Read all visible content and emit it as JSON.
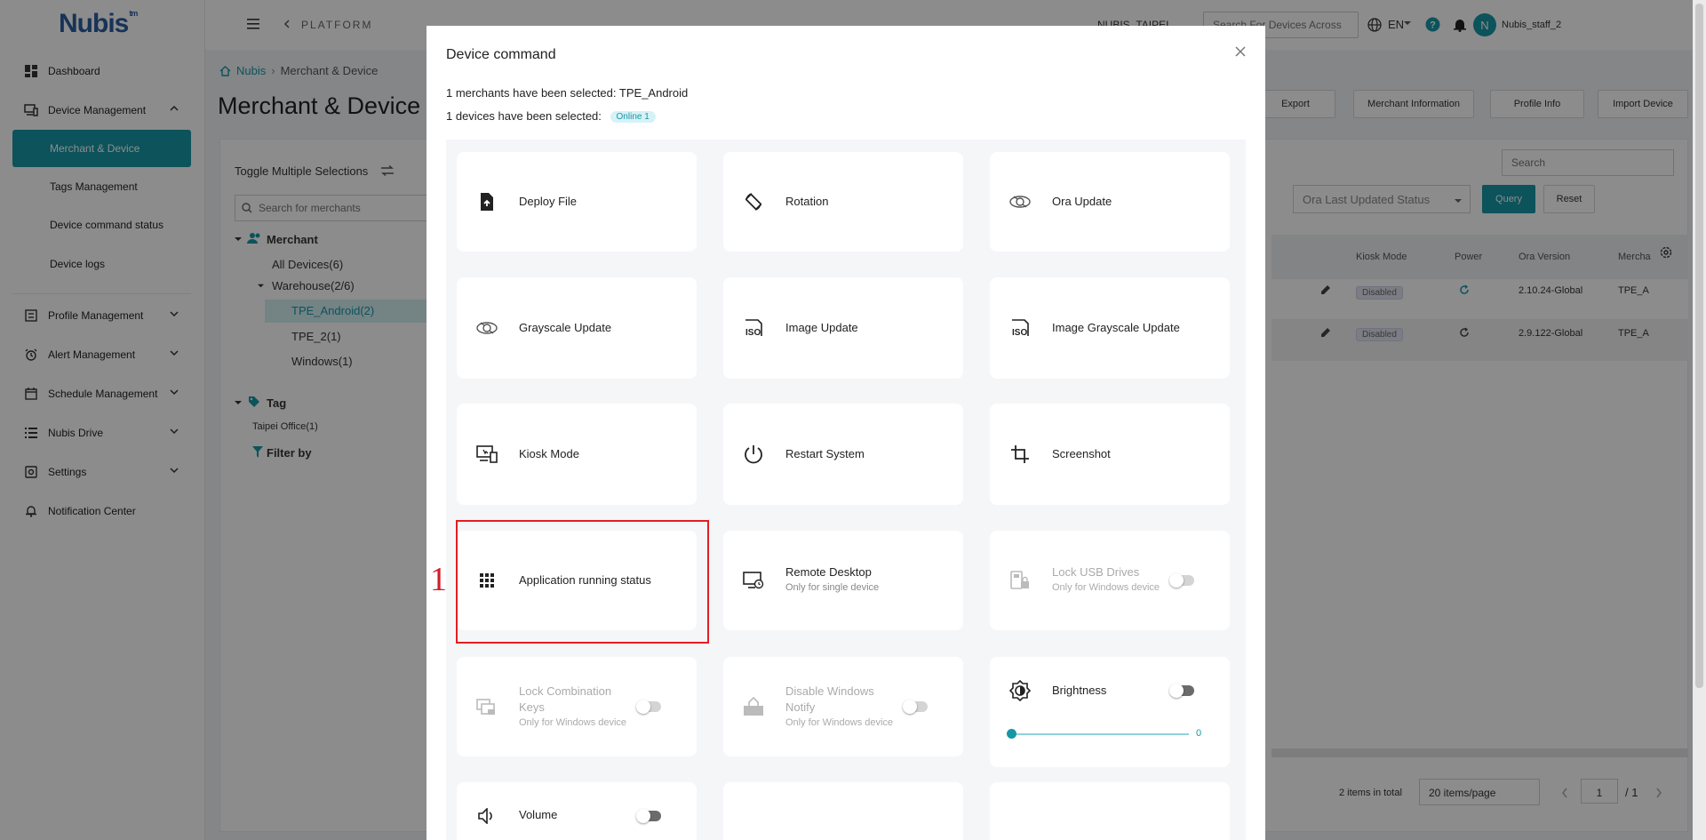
{
  "sidebar": {
    "logo": "Nubis",
    "logo_sup": "tm",
    "items": [
      {
        "label": "Dashboard",
        "icon": "dashboard-icon"
      },
      {
        "label": "Device Management",
        "icon": "device-icon"
      },
      {
        "label": "Merchant & Device"
      },
      {
        "label": "Tags Management"
      },
      {
        "label": "Device command status"
      },
      {
        "label": "Device logs"
      },
      {
        "label": "Profile Management",
        "icon": "profile-icon"
      },
      {
        "label": "Alert Management",
        "icon": "alarm-icon"
      },
      {
        "label": "Schedule Management",
        "icon": "calendar-icon"
      },
      {
        "label": "Nubis Drive",
        "icon": "list-icon"
      },
      {
        "label": "Settings",
        "icon": "settings-icon"
      },
      {
        "label": "Notification Center",
        "icon": "bell-icon"
      }
    ]
  },
  "topbar": {
    "platform": "PLATFORM",
    "org": "NUBIS_TAIPEI",
    "search_placeholder": "Search For Devices Across",
    "lang": "EN",
    "avatar_letter": "N",
    "user": "Nubis_staff_2"
  },
  "main": {
    "breadcrumb_home": "Nubis",
    "breadcrumb_current": "Merchant & Device",
    "title": "Merchant & Device",
    "toggle_multi": "Toggle Multiple Selections",
    "merchant_search_placeholder": "Search for merchants",
    "tree": {
      "merchant": "Merchant",
      "all_devices": "All Devices(6)",
      "warehouse": "Warehouse(2/6)",
      "tpe_android": "TPE_Android(2)",
      "tpe_2": "TPE_2(1)",
      "windows": "Windows(1)",
      "tag": "Tag",
      "taipei_office": "Taipei Office(1)",
      "filter_by": "Filter by"
    },
    "buttons": {
      "export": "Export",
      "merchant_info": "Merchant Information",
      "profile_info": "Profile Info",
      "import_device": "Import Device",
      "query": "Query",
      "reset": "Reset"
    },
    "search_placeholder": "Search",
    "ora_status_placeholder": "Ora Last Updated Status",
    "table": {
      "headers": [
        "Kiosk Mode",
        "Power",
        "Ora Version",
        "Mercha"
      ],
      "rows": [
        {
          "kiosk": "Disabled",
          "ora": "2.10.24-Global",
          "merchant": "TPE_A"
        },
        {
          "kiosk": "Disabled",
          "ora": "2.9.122-Global",
          "merchant": "TPE_A"
        }
      ]
    },
    "pagination": {
      "total": "2 items in total",
      "per_page": "20 items/page",
      "page": "1",
      "of": "/ 1"
    }
  },
  "modal": {
    "title": "Device command",
    "merchants_selected_label": "1 merchants have been selected:",
    "merchants_selected_value": "TPE_Android",
    "devices_selected_label": "1 devices have been selected:",
    "online_badge": "Online 1",
    "commands": [
      {
        "label": "Deploy File",
        "icon": "file-upload-icon"
      },
      {
        "label": "Rotation",
        "icon": "rotation-icon"
      },
      {
        "label": "Ora Update",
        "icon": "ora-update-icon"
      },
      {
        "label": "Grayscale Update",
        "icon": "grayscale-update-icon"
      },
      {
        "label": "Image Update",
        "icon": "iso-image-icon"
      },
      {
        "label": "Image Grayscale Update",
        "icon": "iso-image-grayscale-icon"
      },
      {
        "label": "Kiosk Mode",
        "icon": "kiosk-icon"
      },
      {
        "label": "Restart System",
        "icon": "power-icon"
      },
      {
        "label": "Screenshot",
        "icon": "crop-icon"
      },
      {
        "label": "Application running status",
        "icon": "apps-grid-icon"
      },
      {
        "label": "Remote Desktop",
        "sub": "Only for single device",
        "icon": "remote-desktop-icon"
      },
      {
        "label": "Lock USB Drives",
        "sub": "Only for Windows device",
        "icon": "usb-lock-icon"
      },
      {
        "label": "Lock Combination Keys",
        "sub": "Only for Windows device",
        "icon": "keys-lock-icon"
      },
      {
        "label": "Disable Windows Notify",
        "sub": "Only for Windows device",
        "icon": "notify-disable-icon"
      },
      {
        "label": "Brightness",
        "icon": "brightness-icon",
        "value": "0"
      },
      {
        "label": "Volume",
        "icon": "volume-icon"
      }
    ]
  },
  "annotation": {
    "step": "1"
  },
  "colors": {
    "accent": "#1797a6",
    "highlight": "#e31e24"
  }
}
